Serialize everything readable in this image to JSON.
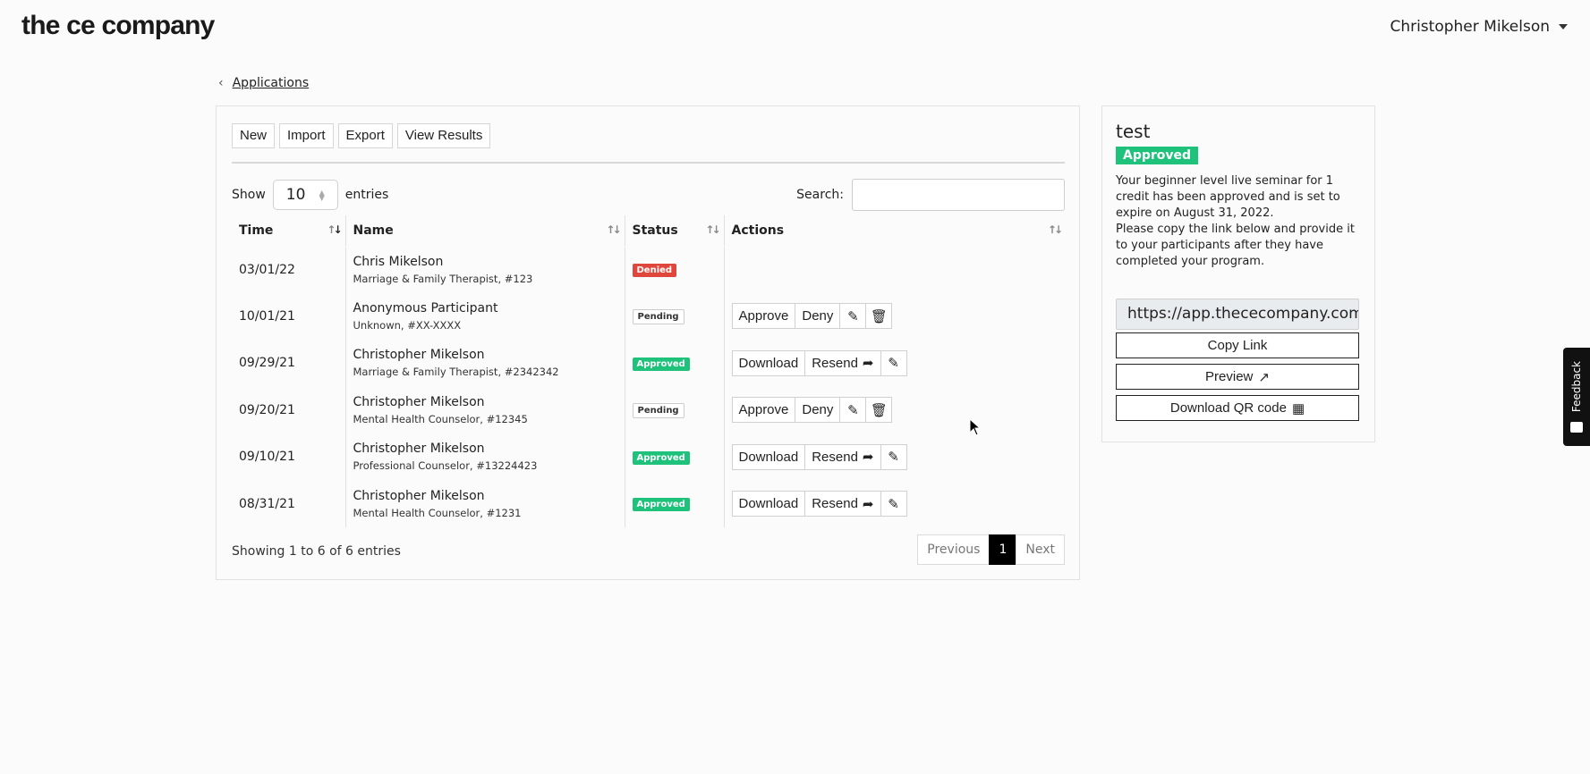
{
  "brand": {
    "logo_text": "the ce company"
  },
  "user": {
    "name": "Christopher Mikelson"
  },
  "breadcrumb": {
    "link": "Applications"
  },
  "toolbar": {
    "buttons": [
      "New",
      "Import",
      "Export",
      "View Results"
    ]
  },
  "table_controls": {
    "show_label": "Show",
    "entries_value": "10",
    "entries_label": "entries",
    "search_label": "Search:",
    "search_value": ""
  },
  "columns": [
    "Time",
    "Name",
    "Status",
    "Actions"
  ],
  "rows": [
    {
      "time": "03/01/22",
      "name": "Chris Mikelson",
      "sub": "Marriage & Family Therapist, #123",
      "status": "Denied"
    },
    {
      "time": "10/01/21",
      "name": "Anonymous Participant",
      "sub": "Unknown, #XX-XXXX",
      "status": "Pending"
    },
    {
      "time": "09/29/21",
      "name": "Christopher Mikelson",
      "sub": "Marriage & Family Therapist, #2342342",
      "status": "Approved"
    },
    {
      "time": "09/20/21",
      "name": "Christopher Mikelson",
      "sub": "Mental Health Counselor, #12345",
      "status": "Pending"
    },
    {
      "time": "09/10/21",
      "name": "Christopher Mikelson",
      "sub": "Professional Counselor, #13224423",
      "status": "Approved"
    },
    {
      "time": "08/31/21",
      "name": "Christopher Mikelson",
      "sub": "Mental Health Counselor, #1231",
      "status": "Approved"
    }
  ],
  "actions": {
    "approve": "Approve",
    "deny": "Deny",
    "download": "Download",
    "resend": "Resend"
  },
  "footer": {
    "info": "Showing 1 to 6 of 6 entries",
    "prev": "Previous",
    "page": "1",
    "next": "Next"
  },
  "side": {
    "title": "test",
    "badge": "Approved",
    "desc": "Your beginner level live seminar for 1 credit has been approved and is set to expire on August 31, 2022.",
    "instructions": "Please copy the link below and provide it to your participants after they have completed your program.",
    "link": "https://app.thececompany.com",
    "copy": "Copy Link",
    "preview": "Preview",
    "qr": "Download QR code"
  },
  "feedback": {
    "label": "Feedback"
  },
  "colors": {
    "approved": "#1fc27b",
    "denied": "#e0473c",
    "active_page": "#000000"
  }
}
